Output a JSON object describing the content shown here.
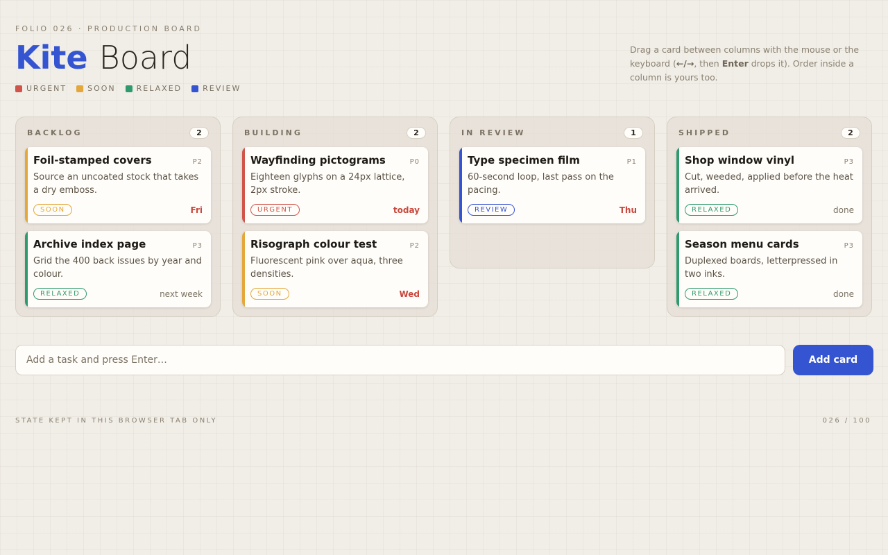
{
  "header": {
    "folio": "FOLIO 026 · PRODUCTION BOARD",
    "title_brand": "Kite",
    "title_rest": "Board"
  },
  "legend": [
    {
      "label": "URGENT",
      "color": "#d0544a"
    },
    {
      "label": "SOON",
      "color": "#e3a73b"
    },
    {
      "label": "RELAXED",
      "color": "#2f9a6e"
    },
    {
      "label": "REVIEW",
      "color": "#3454d1"
    }
  ],
  "hint": {
    "part1": "Drag a card between columns with the mouse or the keyboard (",
    "keys": "←/→",
    "part2": ", then ",
    "enter": "Enter",
    "part3": " drops it). Order inside a column is yours too."
  },
  "columns": [
    {
      "title": "BACKLOG",
      "count": "2",
      "cards": [
        {
          "title": "Foil-stamped covers",
          "priority": "P2",
          "desc": "Source an uncoated stock that takes a dry emboss.",
          "tag": "SOON",
          "tag_color": "#e3a73b",
          "due": "Fri",
          "due_hot": true
        },
        {
          "title": "Archive index page",
          "priority": "P3",
          "desc": "Grid the 400 back issues by year and colour.",
          "tag": "RELAXED",
          "tag_color": "#2f9a6e",
          "due": "next week",
          "due_hot": false
        }
      ]
    },
    {
      "title": "BUILDING",
      "count": "2",
      "cards": [
        {
          "title": "Wayfinding pictograms",
          "priority": "P0",
          "desc": "Eighteen glyphs on a 24px lattice, 2px stroke.",
          "tag": "URGENT",
          "tag_color": "#d0544a",
          "due": "today",
          "due_hot": true
        },
        {
          "title": "Risograph colour test",
          "priority": "P2",
          "desc": "Fluorescent pink over aqua, three densities.",
          "tag": "SOON",
          "tag_color": "#e3a73b",
          "due": "Wed",
          "due_hot": true
        }
      ]
    },
    {
      "title": "IN REVIEW",
      "count": "1",
      "cards": [
        {
          "title": "Type specimen film",
          "priority": "P1",
          "desc": "60-second loop, last pass on the pacing.",
          "tag": "REVIEW",
          "tag_color": "#3454d1",
          "due": "Thu",
          "due_hot": true
        }
      ]
    },
    {
      "title": "SHIPPED",
      "count": "2",
      "cards": [
        {
          "title": "Shop window vinyl",
          "priority": "P3",
          "desc": "Cut, weeded, applied before the heat arrived.",
          "tag": "RELAXED",
          "tag_color": "#2f9a6e",
          "due": "done",
          "due_hot": false
        },
        {
          "title": "Season menu cards",
          "priority": "P3",
          "desc": "Duplexed boards, letterpressed in two inks.",
          "tag": "RELAXED",
          "tag_color": "#2f9a6e",
          "due": "done",
          "due_hot": false
        }
      ]
    }
  ],
  "add": {
    "placeholder": "Add a task and press Enter…",
    "value": "",
    "button_label": "Add card"
  },
  "footer": {
    "left": "STATE KEPT IN THIS BROWSER TAB ONLY",
    "right": "026 / 100"
  }
}
